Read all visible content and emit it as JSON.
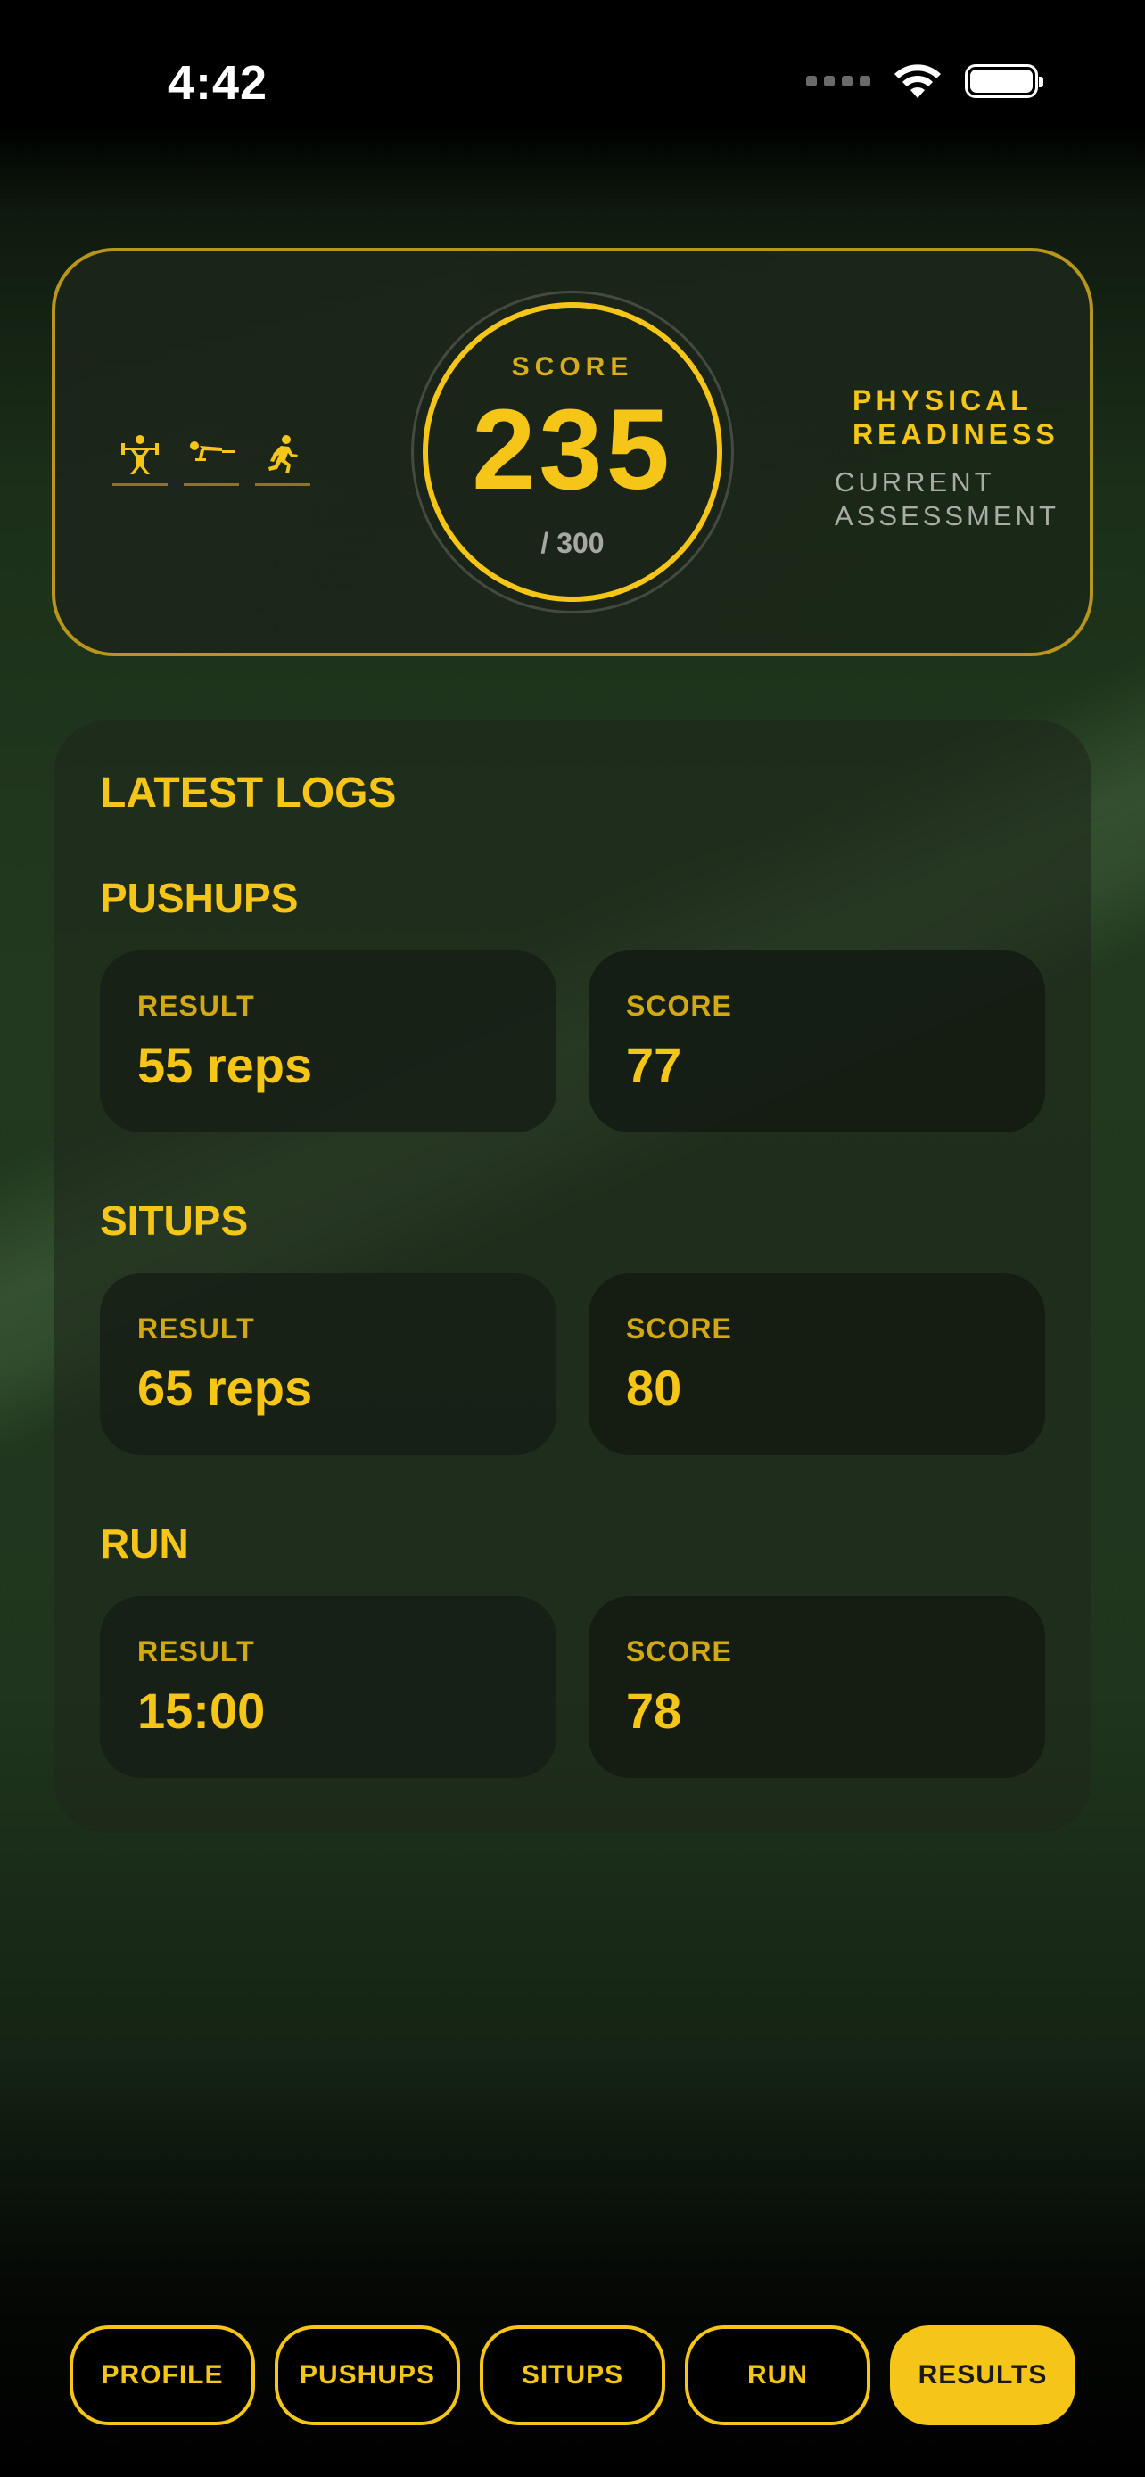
{
  "status_bar": {
    "time": "4:42"
  },
  "colors": {
    "accent": "#F5C518",
    "background": "#1f351d"
  },
  "hero": {
    "icons": [
      "weightlifting-icon",
      "pushup-icon",
      "running-icon"
    ],
    "score_label": "SCORE",
    "score_value": "235",
    "score_max": "/ 300",
    "title_line1": "PHYSICAL",
    "title_line2": "READINESS",
    "subtitle_line1": "CURRENT",
    "subtitle_line2": "ASSESSMENT"
  },
  "logs": {
    "title": "LATEST LOGS",
    "sections": [
      {
        "name": "PUSHUPS",
        "result_label": "RESULT",
        "result_value": "55 reps",
        "score_label": "SCORE",
        "score_value": "77"
      },
      {
        "name": "SITUPS",
        "result_label": "RESULT",
        "result_value": "65 reps",
        "score_label": "SCORE",
        "score_value": "80"
      },
      {
        "name": "RUN",
        "result_label": "RESULT",
        "result_value": "15:00",
        "score_label": "SCORE",
        "score_value": "78"
      }
    ]
  },
  "nav": {
    "tabs": [
      {
        "label": "PROFILE",
        "active": false
      },
      {
        "label": "PUSHUPS",
        "active": false
      },
      {
        "label": "SITUPS",
        "active": false
      },
      {
        "label": "RUN",
        "active": false
      },
      {
        "label": "RESULTS",
        "active": true
      }
    ]
  }
}
